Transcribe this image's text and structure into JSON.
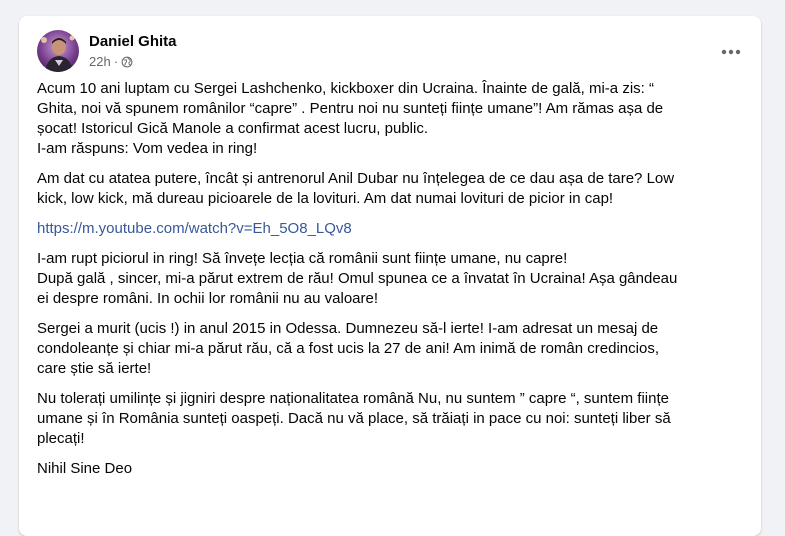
{
  "post": {
    "author": "Daniel Ghita",
    "time": "22h",
    "separator": "·",
    "privacy_icon": "globe-icon",
    "more_icon": "more-options-icon",
    "paragraphs": [
      {
        "lines": [
          "Acum 10 ani luptam cu Sergei Lashchenko, kickboxer din Ucraina. Înainte de gală, mi-a zis: “",
          "Ghita, noi vă spunem românilor “capre” . Pentru noi nu sunteți ființe umane”! Am rămas așa de",
          "șocat! Istoricul Gică Manole a confirmat acest lucru, public.",
          "I-am răspuns: Vom vedea in ring!"
        ]
      },
      {
        "lines": [
          "Am dat cu atatea putere, încât și antrenorul Anil Dubar nu înțelegea de ce dau așa de tare? Low",
          "kick, low kick, mă dureau picioarele de la lovituri. Am dat numai lovituri de picior in cap!"
        ]
      },
      {
        "link": "https://m.youtube.com/watch?v=Eh_5O8_LQv8"
      },
      {
        "lines": [
          "I-am rupt piciorul in ring! Să învețe lecția că românii  sunt ființe umane, nu capre!",
          "După gală , sincer,  mi-a părut extrem de rău! Omul spunea ce a învatat în Ucraina! Așa gândeau",
          "ei despre  români. In ochii lor românii nu au valoare!"
        ]
      },
      {
        "lines": [
          "Sergei a murit (ucis !) in anul 2015 in Odessa. Dumnezeu să-l ierte! I-am adresat un mesaj de",
          "condoleanțe și chiar mi-a părut rău, că a fost ucis la 27 de ani! Am inimă de român credincios,",
          "care știe să ierte!"
        ]
      },
      {
        "lines": [
          "Nu tolerați umilințe și jigniri despre naționalitatea română Nu, nu suntem ” capre “, suntem ființe",
          "umane și în România sunteți oaspeți. Dacă nu vă place, să trăiați in pace  cu noi: sunteți liber să",
          "plecați!"
        ]
      },
      {
        "lines": [
          "Nihil Sine Deo"
        ]
      }
    ]
  },
  "colors": {
    "page_bg": "#f0f2f5",
    "card_bg": "#ffffff",
    "text": "#050505",
    "secondary_text": "#65676b",
    "link": "#385898"
  }
}
